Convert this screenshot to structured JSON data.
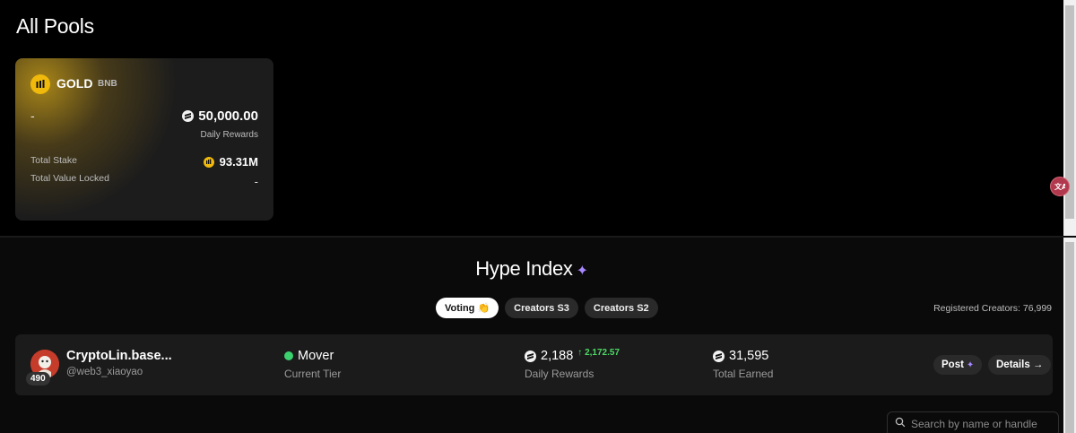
{
  "pools": {
    "title": "All Pools",
    "card": {
      "name": "GOLD",
      "chain": "BNB",
      "left_value": "-",
      "daily_rewards_value": "50,000.00",
      "daily_rewards_label": "Daily Rewards",
      "total_stake_label": "Total Stake",
      "total_stake_value": "93.31M",
      "tvl_label": "Total Value Locked",
      "tvl_value": "-"
    }
  },
  "hype": {
    "title": "Hype Index",
    "tabs": [
      {
        "label": "Voting 👏",
        "active": true
      },
      {
        "label": "Creators S3",
        "active": false
      },
      {
        "label": "Creators S2",
        "active": false
      }
    ],
    "registered": "Registered Creators: 76,999",
    "creator": {
      "rank": "490",
      "name": "CryptoLin.base...",
      "handle": "@web3_xiaoyao",
      "tier": "Mover",
      "tier_label": "Current Tier",
      "daily_rewards": "2,188",
      "daily_change": "↑ 2,172.57",
      "daily_label": "Daily Rewards",
      "total_earned": "31,595",
      "total_earned_label": "Total Earned",
      "post_label": "Post",
      "details_label": "Details →"
    },
    "search_placeholder": "Search by name or handle"
  },
  "colors": {
    "accent_gold": "#f0b90b",
    "accent_purple": "#a988ff",
    "positive_green": "#4cd964"
  }
}
